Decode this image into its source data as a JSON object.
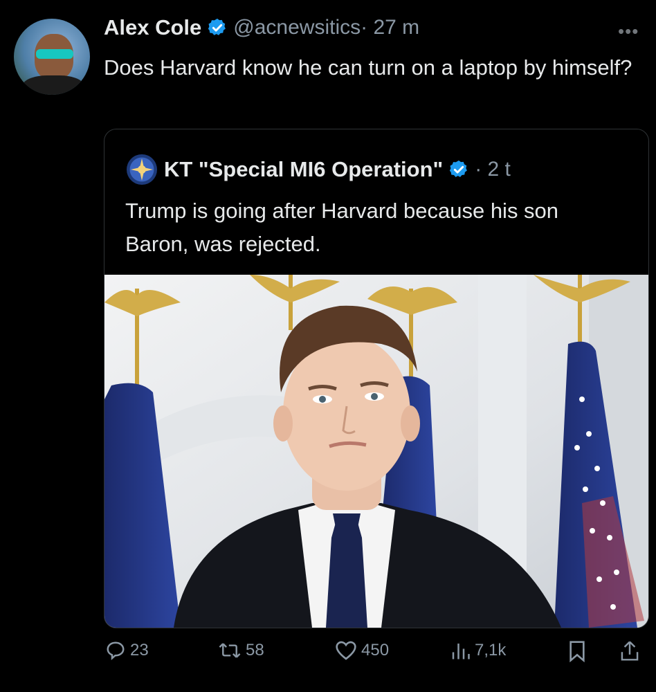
{
  "author": {
    "name": "Alex Cole",
    "handle": "@acnewsitics",
    "time": "· 27 m"
  },
  "tweet": {
    "text": "Does Harvard know he can turn on a laptop by himself?"
  },
  "quoted": {
    "name": "KT \"Special MI6 Operation\"",
    "time": "· 2 t",
    "text": "Trump is going after Harvard because his son Baron, was rejected."
  },
  "metrics": {
    "replies": "23",
    "retweets": "58",
    "likes": "450",
    "views": "7,1k"
  },
  "colors": {
    "background": "#000000",
    "verified": "#1d9bf0",
    "secondary_text": "#8b98a5"
  },
  "icons": [
    "verified-icon",
    "more-icon",
    "reply-icon",
    "retweet-icon",
    "like-icon",
    "views-icon",
    "bookmark-icon",
    "share-icon"
  ]
}
